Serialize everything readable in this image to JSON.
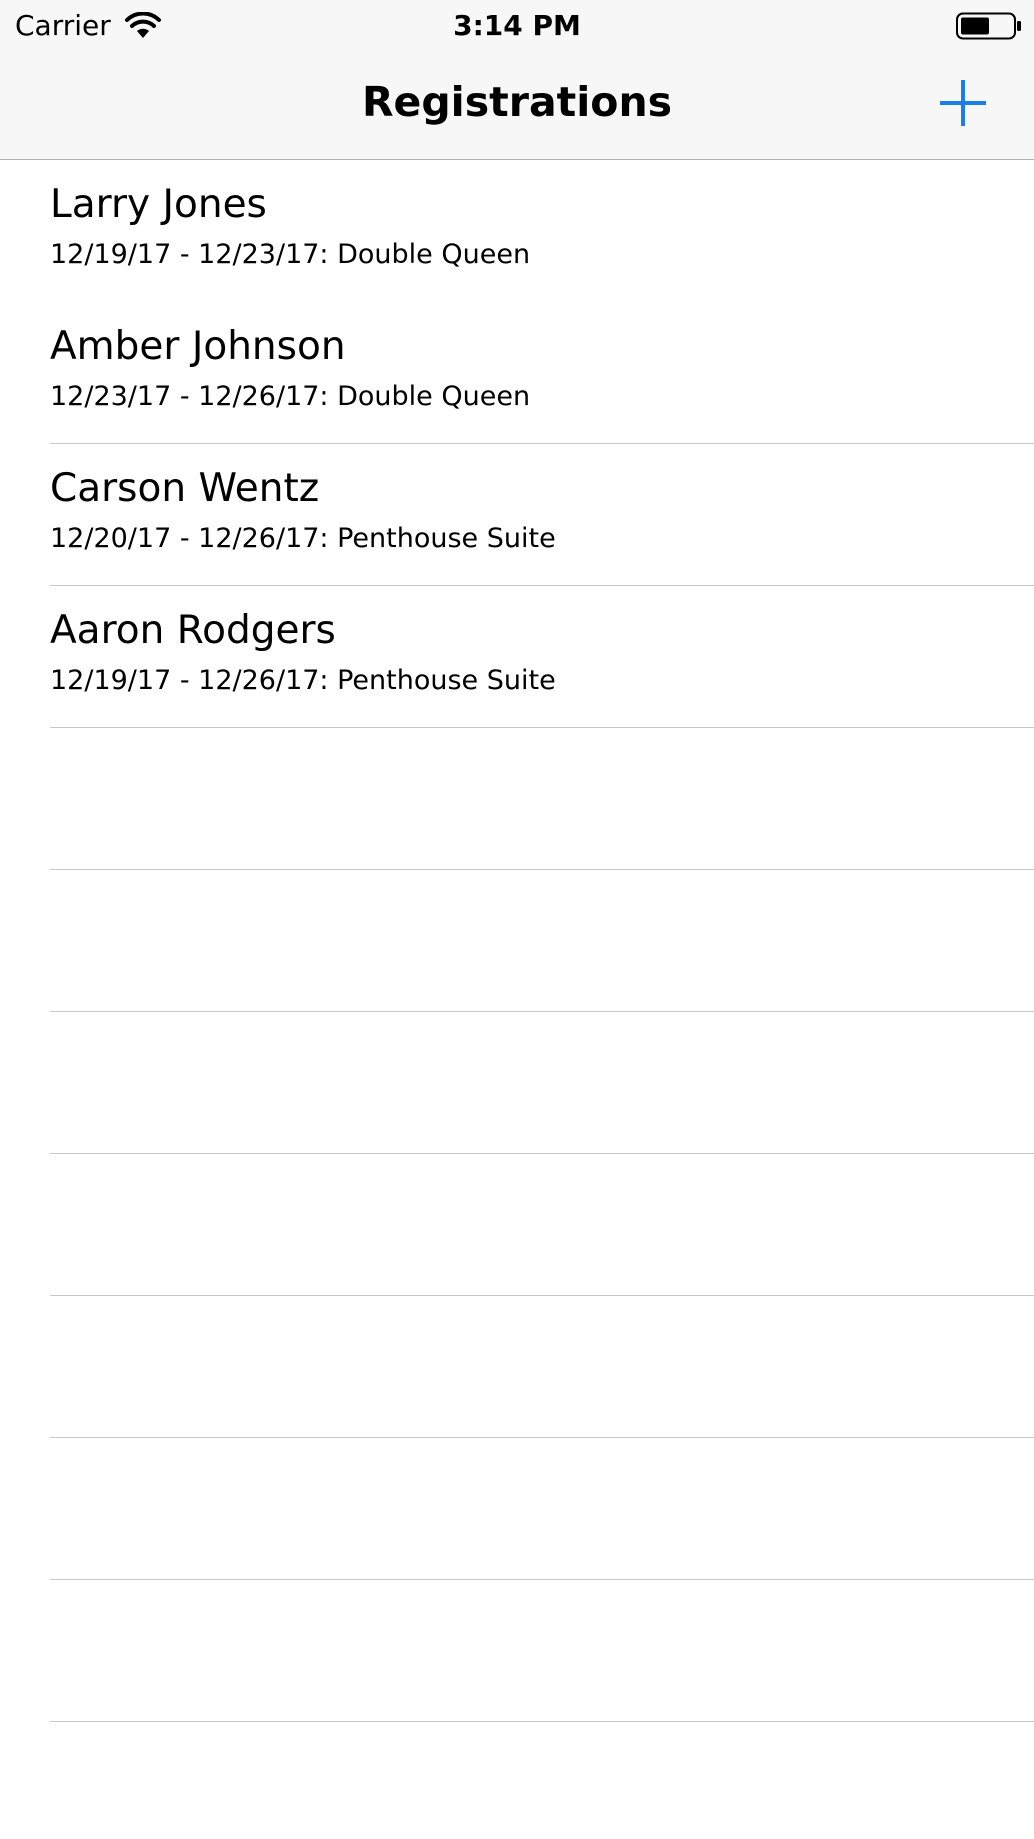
{
  "status_bar": {
    "carrier": "Carrier",
    "time": "3:14 PM",
    "wifi_icon": "wifi-icon",
    "battery_icon": "battery-icon"
  },
  "nav_bar": {
    "title": "Registrations",
    "add_icon": "plus-icon",
    "accent_color": "#1a7ee8"
  },
  "registrations": [
    {
      "name": "Larry Jones",
      "detail": "12/19/17 - 12/23/17: Double Queen"
    },
    {
      "name": "Amber Johnson",
      "detail": "12/23/17 - 12/26/17: Double Queen"
    },
    {
      "name": "Carson Wentz",
      "detail": "12/20/17 - 12/26/17: Penthouse Suite"
    },
    {
      "name": "Aaron Rodgers",
      "detail": "12/19/17 - 12/26/17: Penthouse Suite"
    }
  ],
  "colors": {
    "bar_background": "#f7f7f7",
    "separator": "#c8c7cc"
  }
}
